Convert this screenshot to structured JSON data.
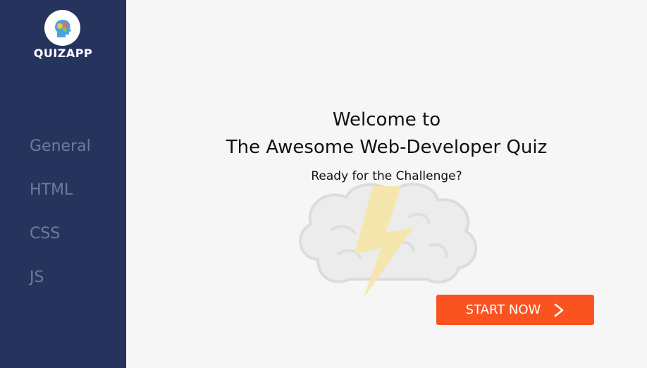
{
  "sidebar": {
    "brand": "QUIZAPP",
    "logo_icon": "brain-head-icon",
    "items": [
      {
        "label": "General"
      },
      {
        "label": "HTML"
      },
      {
        "label": "CSS"
      },
      {
        "label": "JS"
      }
    ]
  },
  "main": {
    "welcome_line1": "Welcome to",
    "welcome_line2": "The Awesome Web-Developer Quiz",
    "subtitle": "Ready for the Challenge?",
    "start_button": {
      "label": "START NOW",
      "icon": "chevron-right-icon"
    },
    "background_icon": "brain-lightning-icon"
  },
  "colors": {
    "sidebar_bg": "#26335d",
    "nav_text": "#6f7a9b",
    "main_bg": "#f6f6f6",
    "accent": "#fb5320"
  }
}
